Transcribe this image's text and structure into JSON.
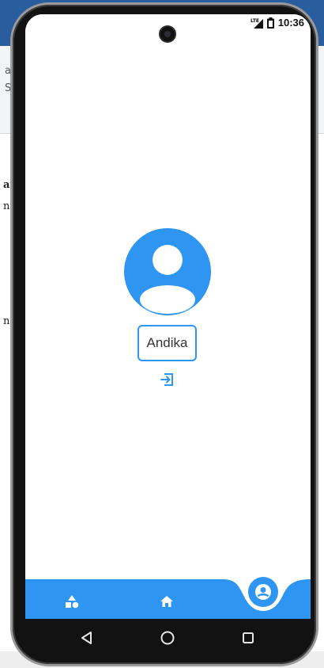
{
  "background": {
    "fragments": [
      "a",
      "Sı",
      "ar",
      "na",
      "n,"
    ]
  },
  "status_bar": {
    "network": "LTE",
    "time": "10:36",
    "icons": [
      "lte-signal-icon",
      "battery-icon"
    ]
  },
  "profile": {
    "avatar_icon": "user-avatar-icon",
    "name": "Andika",
    "logout_icon": "logout-icon"
  },
  "bottom_nav": {
    "items": [
      {
        "icon": "shapes-icon",
        "active": false
      },
      {
        "icon": "home-icon",
        "active": false
      },
      {
        "icon": "account-circle-icon",
        "active": true
      }
    ]
  },
  "system_nav": {
    "buttons": [
      "back-triangle-icon",
      "home-circle-icon",
      "recents-square-icon"
    ]
  },
  "colors": {
    "accent": "#2e95f2",
    "phone_body": "#121212",
    "screen": "#ffffff"
  }
}
